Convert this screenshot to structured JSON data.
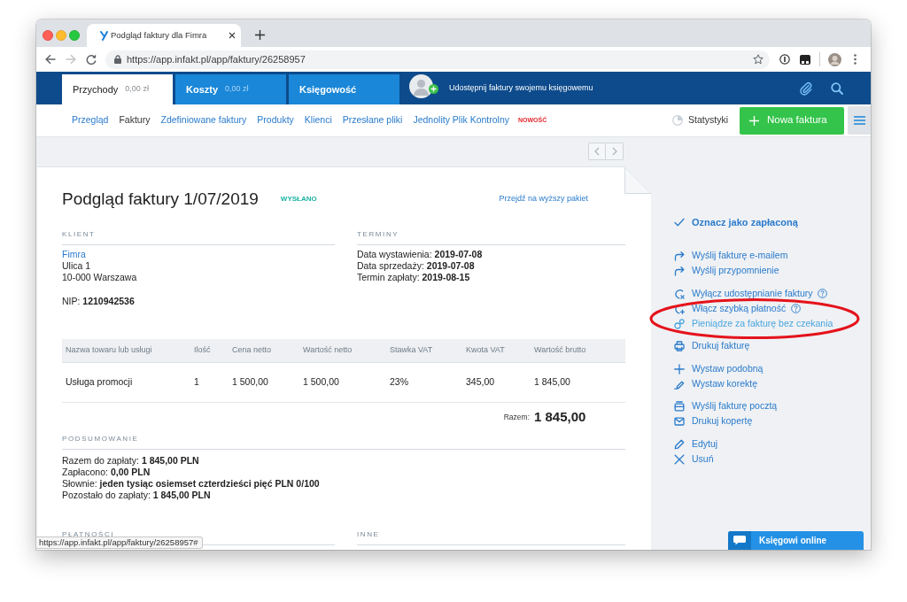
{
  "browser": {
    "tab_title": "Podgląd faktury dla Fimra",
    "url": "https://app.infakt.pl/app/faktury/26258957",
    "forward_disabled": true,
    "status_url": "https://app.infakt.pl/app/faktury/26258957#"
  },
  "app_tabs": [
    {
      "label": "Przychody",
      "amount": "0,00 zł",
      "selected": true
    },
    {
      "label": "Koszty",
      "amount": "0,00 zł",
      "selected": false
    },
    {
      "label": "Księgowość",
      "selected": false
    }
  ],
  "share_prompt": "Udostępnij faktury swojemu księgowemu",
  "subnav": {
    "items": [
      {
        "label": "Przegląd",
        "selected": false
      },
      {
        "label": "Faktury",
        "selected": true
      },
      {
        "label": "Zdefiniowane faktury",
        "selected": false
      },
      {
        "label": "Produkty",
        "selected": false
      },
      {
        "label": "Klienci",
        "selected": false
      },
      {
        "label": "Przesłane pliki",
        "selected": false
      },
      {
        "label": "Jednolity Plik Kontrolny",
        "selected": false,
        "badge": "NOWOŚĆ"
      }
    ],
    "statistics": "Statystyki",
    "new_invoice_button": "Nowa faktura"
  },
  "invoice": {
    "title": "Podgląd faktury 1/07/2019",
    "status": "WYSŁANO",
    "upgrade_link": "Przejdź na wyższy pakiet",
    "client": {
      "heading": "KLIENT",
      "name": "Fimra",
      "address": [
        "Ulica 1",
        "10-000 Warszawa"
      ],
      "tax_id": "NIP: **1210942536**"
    },
    "terms": {
      "heading": "TERMINY",
      "lines": [
        "Data wystawienia: **2019-07-08**",
        "Data sprzedaży: **2019-07-08**",
        "Termin zapłaty: **2019-08-15**"
      ]
    },
    "table": {
      "columns": [
        "Nazwa towaru lub usługi",
        "Ilość",
        "Cena netto",
        "Wartość netto",
        "Stawka VAT",
        "Kwota VAT",
        "Wartość brutto"
      ],
      "rows": [
        [
          "Usługa promocji",
          "1",
          "1 500,00",
          "1 500,00",
          "23%",
          "345,00",
          "1 845,00"
        ]
      ]
    },
    "total": {
      "label": "Razem:",
      "value": "1 845,00"
    },
    "summary": {
      "heading": "PODSUMOWANIE",
      "lines": [
        "Razem do zapłaty: **1 845,00 PLN**",
        "Zapłacono: **0,00 PLN**",
        "Słownie: **jeden tysiąc osiemset czterdzieści pięć PLN 0/100**",
        "Pozostało do zapłaty: **1 845,00 PLN**"
      ]
    },
    "payments": {
      "heading": "PŁATNOŚCI"
    },
    "other": {
      "heading": "INNE"
    }
  },
  "actions": [
    {
      "items": [
        {
          "label": "Oznacz jako zapłaconą",
          "kind": "primary",
          "help": false
        }
      ]
    },
    {
      "items": [
        {
          "label": "Wyślij fakturę e-mailem",
          "kind": "link",
          "help": false
        },
        {
          "label": "Wyślij przypomnienie",
          "kind": "link",
          "help": false
        }
      ]
    },
    {
      "items": [
        {
          "label": "Wyłącz udostępnianie faktury",
          "kind": "link",
          "help": true
        },
        {
          "label": "Włącz szybką płatność",
          "kind": "link",
          "help": true
        },
        {
          "label": "Pieniądze za fakturę bez czekania",
          "kind": "promo",
          "help": false
        }
      ]
    },
    {
      "items": [
        {
          "label": "Drukuj fakturę",
          "kind": "link",
          "help": false
        }
      ]
    },
    {
      "items": [
        {
          "label": "Wystaw podobną",
          "kind": "link",
          "help": false
        },
        {
          "label": "Wystaw korektę",
          "kind": "link",
          "help": false
        }
      ]
    },
    {
      "items": [
        {
          "label": "Wyślij fakturę pocztą",
          "kind": "link",
          "help": false
        },
        {
          "label": "Drukuj kopertę",
          "kind": "link",
          "help": false
        }
      ]
    },
    {
      "items": [
        {
          "label": "Edytuj",
          "kind": "link",
          "help": false
        },
        {
          "label": "Usuń",
          "kind": "link",
          "help": false
        }
      ]
    }
  ],
  "chat_button": "Księgowi online"
}
